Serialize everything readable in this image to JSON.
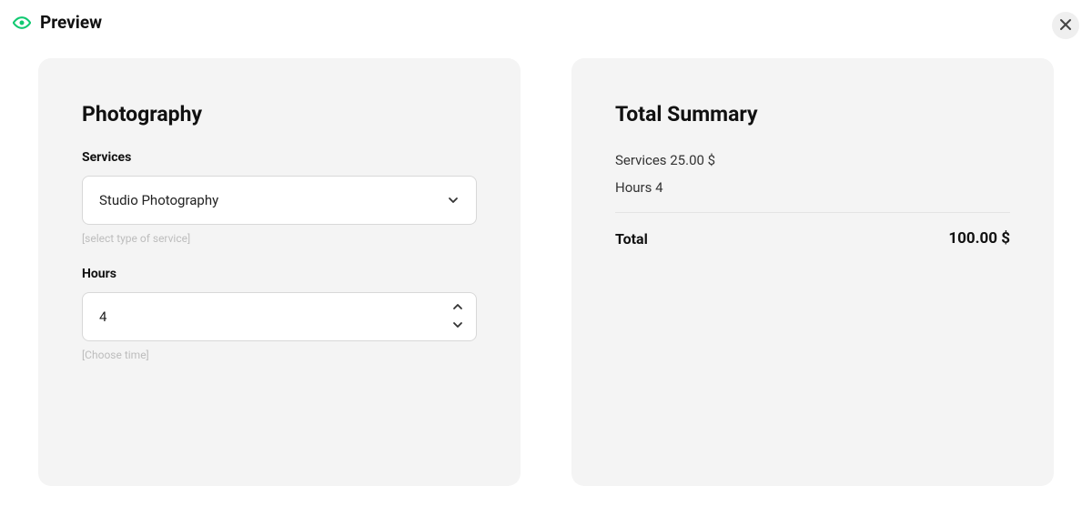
{
  "header": {
    "title": "Preview"
  },
  "form": {
    "title": "Photography",
    "services": {
      "label": "Services",
      "selected": "Studio Photography",
      "hint": "[select type of service]"
    },
    "hours": {
      "label": "Hours",
      "value": "4",
      "hint": "[Choose time]"
    }
  },
  "summary": {
    "title": "Total Summary",
    "services_line": "Services 25.00 $",
    "hours_line": "Hours 4",
    "total_label": "Total",
    "total_amount": "100.00 $"
  }
}
